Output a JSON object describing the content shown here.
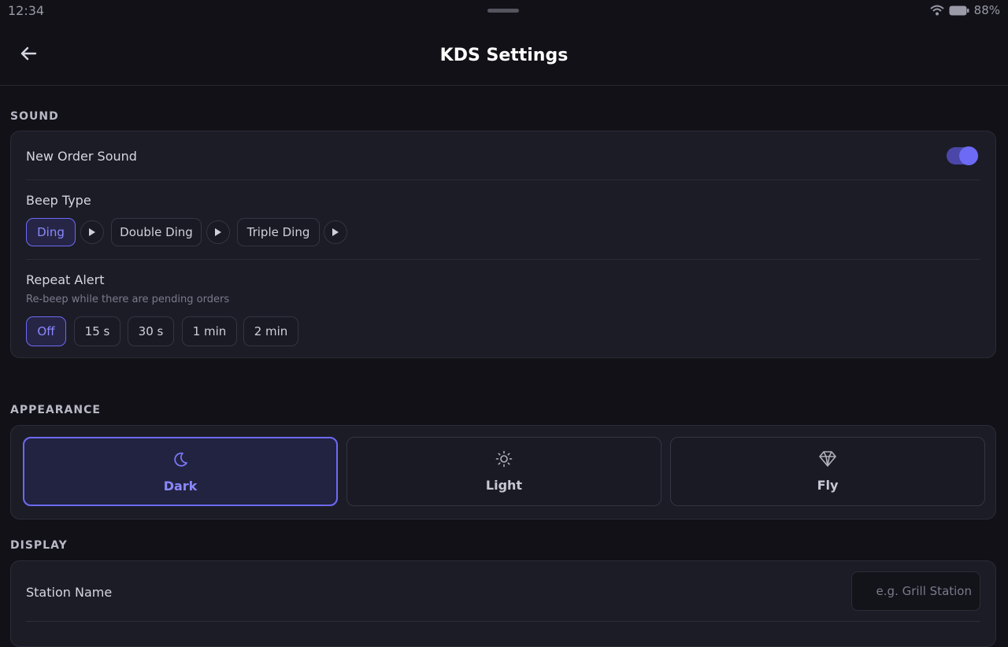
{
  "status_bar": {
    "time": "12:34",
    "battery": "88%"
  },
  "header": {
    "title": "KDS Settings"
  },
  "sound": {
    "section_label": "SOUND",
    "new_order_sound": {
      "label": "New Order Sound",
      "enabled": true
    },
    "beep_type": {
      "label": "Beep Type",
      "options": [
        "Ding",
        "Double Ding",
        "Triple Ding"
      ],
      "selected": "Ding"
    },
    "repeat_alert": {
      "label": "Repeat Alert",
      "subtitle": "Re-beep while there are pending orders",
      "options": [
        "Off",
        "15 s",
        "30 s",
        "1 min",
        "2 min"
      ],
      "selected": "Off"
    }
  },
  "appearance": {
    "section_label": "APPEARANCE",
    "themes": [
      {
        "label": "Dark",
        "icon": "moon-icon"
      },
      {
        "label": "Light",
        "icon": "sun-icon"
      },
      {
        "label": "Fly",
        "icon": "diamond-icon"
      }
    ],
    "selected": "Dark"
  },
  "display": {
    "section_label": "DISPLAY",
    "station_name": {
      "label": "Station Name",
      "value": "",
      "placeholder": "e.g. Grill Station"
    }
  },
  "colors": {
    "accent": "#6d6af5",
    "background": "#111117",
    "card": "#1c1c27"
  }
}
